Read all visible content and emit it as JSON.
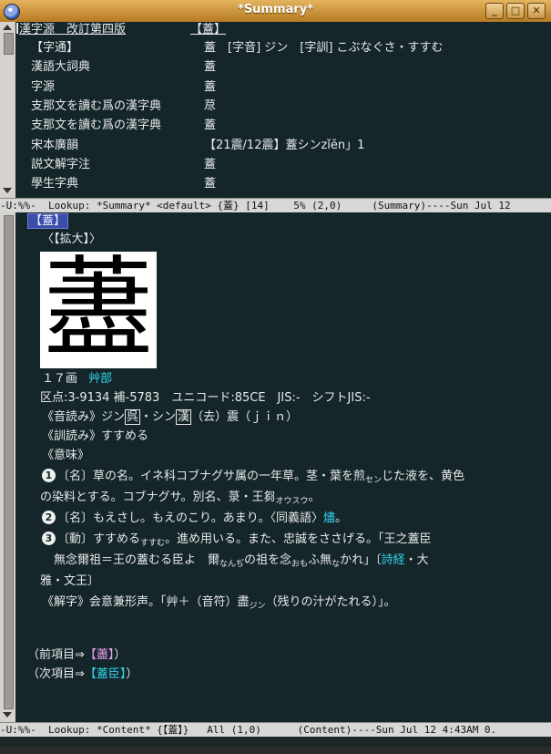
{
  "window": {
    "title": "*Summary*",
    "buttons": [
      "_",
      "□",
      "✕"
    ]
  },
  "summary": {
    "header_title": "漢字源　改訂第四版",
    "header_value": "【蓋】",
    "rows": [
      {
        "label": "【字通】",
        "value": "蓋　[字音] ジン　[字訓] こぶなぐさ・すすむ"
      },
      {
        "label": "漢語大詞典",
        "value": "蓋"
      },
      {
        "label": "字源",
        "value": "蓋"
      },
      {
        "label": "支那文を讀む爲の漢字典",
        "value": "荩"
      },
      {
        "label": "支那文を讀む爲の漢字典",
        "value": "蓋"
      },
      {
        "label": "宋本廣韻",
        "value": "【21震/12震】蓋シンzǐěn」1"
      },
      {
        "label": "説文解字注",
        "value": "蓋"
      },
      {
        "label": "學生字典",
        "value": "蓋"
      }
    ]
  },
  "modeline_top": "-U:%%-  Lookup: *Summary* <default> {蓋} [14]    5% (2,0)     (Summary)----Sun Jul 12",
  "modeline_bottom": "-U:%%-  Lookup: *Content* {【蓋】}   All (1,0)      (Content)----Sun Jul 12 4:43AM 0.",
  "content": {
    "heading": "【蓋】",
    "enlarge": "〈【拡大】〉",
    "big_char": "藎",
    "strokes": "１７画",
    "radical": "艸部",
    "codes": "区点:3-9134 補-5783　ユニコード:85CE　JIS:-　シフトJIS:-",
    "onyomi_prefix": "《音読み》ジン",
    "onyomi_mark1": "呉",
    "onyomi_mid": "・シン",
    "onyomi_mark2": "漢",
    "onyomi_rest": "（去）震（ｊｉｎ）",
    "kunyomi": "《訓読み》すすめる",
    "meaning_header": "《意味》",
    "m1_num": "1",
    "m1_line1": "〔名〕草の名。イネ科コブナグサ属の一年草。茎・葉を煎",
    "m1_ruby1": "セン",
    "m1_line1b": "じた液を、黄色",
    "m1_line2": "の染料とする。コブナグサ。別名、菉・王芻",
    "m1_ruby2": "オウスウ",
    "m1_line2b": "。",
    "m2_num": "2",
    "m2_text": "〔名〕もえさし。もえのこり。あまり。〈同義語〉",
    "m2_link": "燼",
    "m2_end": "。",
    "m3_num": "3",
    "m3_text": "〔動〕すすめる",
    "m3_ruby": "すすむ",
    "m3_text2": "。進め用いる。また、忠誠をささげる。「王之蓋臣",
    "m3_line2a": "　無念爾祖＝王の蓋むる臣よ　爾",
    "m3_ruby2": "なんぢ",
    "m3_line2b": "の祖を念",
    "m3_ruby3": "おも",
    "m3_line2c": "ふ無",
    "m3_ruby4": "な",
    "m3_line2d": "かれ」〔",
    "m3_link": "詩経",
    "m3_line2e": "・大",
    "m3_line3": "雅・文王〕",
    "kaiji": "《解字》会意兼形声。「艸＋（音符）盡",
    "kaiji_ruby": "ジン",
    "kaiji_end": "（残りの汁がたれる）」。",
    "prev_label": "（前項目⇒",
    "prev_link": "【藎】",
    "prev_end": "）",
    "next_label": "（次項目⇒",
    "next_link": "【蓋臣】",
    "next_end": "）"
  }
}
